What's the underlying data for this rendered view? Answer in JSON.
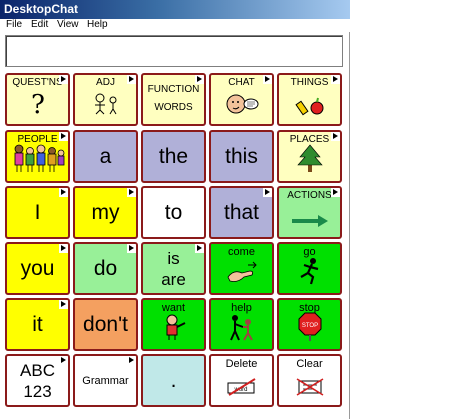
{
  "window": {
    "title": "DesktopChat"
  },
  "menu": [
    "File",
    "Edit",
    "View",
    "Help"
  ],
  "message_bar": {
    "value": ""
  },
  "colors": {
    "yellow": "#ffff00",
    "lightyellow": "#ffffc0",
    "lavender": "#b0b0d8",
    "lightgreen": "#98f098",
    "green": "#00e000",
    "orange": "#f4a060",
    "white": "#ffffff",
    "teal": "#c0e8e8",
    "border": "#8b1a1a"
  },
  "grid": {
    "rows": [
      [
        {
          "label": "QUEST'NS",
          "glyph": "?",
          "style": "small",
          "icon": "question-mark-icon",
          "bg": "lightyellow",
          "folder": true
        },
        {
          "label": "ADJ",
          "style": "small",
          "icon": "adjectives-icon",
          "bg": "lightyellow",
          "folder": true
        },
        {
          "label": "FUNCTION WORDS",
          "style": "two",
          "icon": "",
          "bg": "lightyellow",
          "folder": true
        },
        {
          "label": "CHAT",
          "style": "small",
          "icon": "chat-face-icon",
          "bg": "lightyellow",
          "folder": true
        },
        {
          "label": "THINGS",
          "style": "small",
          "icon": "things-icon",
          "bg": "lightyellow",
          "folder": true
        }
      ],
      [
        {
          "label": "PEOPLE",
          "style": "small",
          "icon": "people-group-icon",
          "bg": "yellow",
          "folder": true
        },
        {
          "label": "a",
          "style": "big",
          "icon": "",
          "bg": "lavender",
          "folder": false
        },
        {
          "label": "the",
          "style": "big",
          "icon": "",
          "bg": "lavender",
          "folder": false
        },
        {
          "label": "this",
          "style": "big",
          "icon": "",
          "bg": "lavender",
          "folder": false
        },
        {
          "label": "PLACES",
          "style": "small",
          "icon": "tree-icon",
          "bg": "lightyellow",
          "folder": true
        }
      ],
      [
        {
          "label": "I",
          "style": "big",
          "icon": "",
          "bg": "yellow",
          "folder": true
        },
        {
          "label": "my",
          "style": "big",
          "icon": "",
          "bg": "yellow",
          "folder": true
        },
        {
          "label": "to",
          "style": "big",
          "icon": "",
          "bg": "white",
          "folder": false
        },
        {
          "label": "that",
          "style": "big",
          "icon": "",
          "bg": "lavender",
          "folder": true
        },
        {
          "label": "ACTIONS",
          "style": "small",
          "icon": "right-arrow-icon",
          "bg": "lightgreen",
          "folder": true
        }
      ],
      [
        {
          "label": "you",
          "style": "big",
          "icon": "",
          "bg": "yellow",
          "folder": true
        },
        {
          "label": "do",
          "style": "big",
          "icon": "",
          "bg": "lightgreen",
          "folder": true
        },
        {
          "label": "is are",
          "style": "bigtwo",
          "icon": "",
          "bg": "lightgreen",
          "folder": true
        },
        {
          "label": "come",
          "style": "small",
          "icon": "come-hand-icon",
          "bg": "green",
          "folder": false
        },
        {
          "label": "go",
          "style": "small",
          "icon": "running-person-icon",
          "bg": "green",
          "folder": false
        }
      ],
      [
        {
          "label": "it",
          "style": "big",
          "icon": "",
          "bg": "yellow",
          "folder": true
        },
        {
          "label": "don't",
          "style": "big",
          "icon": "",
          "bg": "orange",
          "folder": false
        },
        {
          "label": "want",
          "style": "small",
          "icon": "want-person-icon",
          "bg": "green",
          "folder": false
        },
        {
          "label": "help",
          "style": "small",
          "icon": "help-people-icon",
          "bg": "green",
          "folder": false
        },
        {
          "label": "stop",
          "style": "small",
          "icon": "stop-sign-icon",
          "bg": "green",
          "folder": false
        }
      ],
      [
        {
          "label": "ABC 123",
          "style": "bigtwo-sm",
          "icon": "",
          "bg": "white",
          "folder": true
        },
        {
          "label": "Grammar",
          "style": "mid",
          "icon": "",
          "bg": "white",
          "folder": true
        },
        {
          "label": ".",
          "style": "big",
          "icon": "",
          "bg": "teal",
          "folder": false
        },
        {
          "label": "Delete",
          "style": "small",
          "icon": "delete-word-icon",
          "bg": "white",
          "folder": false
        },
        {
          "label": "Clear",
          "style": "small",
          "icon": "clear-icon",
          "bg": "white",
          "folder": false
        }
      ]
    ]
  }
}
